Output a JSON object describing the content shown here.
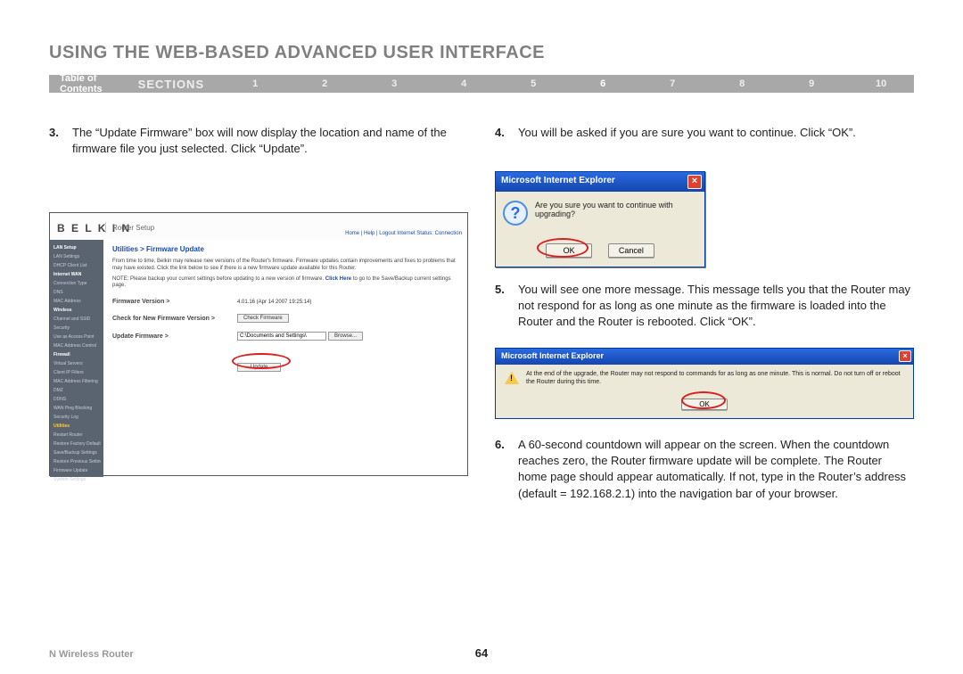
{
  "page": {
    "title": "USING THE WEB-BASED ADVANCED USER INTERFACE",
    "footer_product": "N Wireless Router",
    "page_number": "64"
  },
  "nav": {
    "toc": "Table of Contents",
    "sections_label": "SECTIONS",
    "items": [
      "1",
      "2",
      "3",
      "4",
      "5",
      "6",
      "7",
      "8",
      "9",
      "10"
    ],
    "active": "6"
  },
  "steps": {
    "s3": {
      "num": "3.",
      "text": "The “Update Firmware” box will now display the location and name of the firmware file you just selected. Click “Update”."
    },
    "s4": {
      "num": "4.",
      "text": "You will be asked if you are sure you want to continue. Click “OK”."
    },
    "s5": {
      "num": "5.",
      "text": "You will see one more message. This message tells you that the Router may not respond for as long as one minute as the firmware is loaded into the Router and the Router is rebooted. Click “OK”."
    },
    "s6": {
      "num": "6.",
      "text": "A 60-second countdown will appear on the screen. When the countdown reaches zero, the Router firmware update will be complete. The Router home page should appear automatically. If not, type in the Router’s address (default = 192.168.2.1) into the navigation bar of your browser."
    }
  },
  "belkin_panel": {
    "brand": "B E L K I N",
    "subtitle": "Router Setup",
    "top_links": "Home | Help | Logout   Internet Status: Connection",
    "breadcrumb": "Utilities > Firmware Update",
    "intro": "From time to time, Belkin may release new versions of the Router's firmware. Firmware updates contain improvements and fixes to problems that may have existed. Click the link below to see if there is a new firmware update available for this Router.",
    "note_prefix": "NOTE: Please backup your current settings before updating to a new version of firmware. ",
    "note_link": "Click Here",
    "note_suffix": " to go to the Save/Backup current settings page.",
    "fw_version_label": "Firmware Version >",
    "fw_version_value": "4.01.16 (Apr 14 2007 19:25:14)",
    "check_label": "Check for New Firmware Version >",
    "check_btn": "Check Firmware",
    "update_label": "Update Firmware >",
    "file_path": "C:\\Documents and Settings\\",
    "browse_btn": "Browse...",
    "update_btn": "Update",
    "sidebar": [
      {
        "t": "LAN Setup",
        "b": true
      },
      {
        "t": "LAN Settings"
      },
      {
        "t": "DHCP Client List"
      },
      {
        "t": "Internet WAN",
        "b": true
      },
      {
        "t": "Connection Type"
      },
      {
        "t": "DNS"
      },
      {
        "t": "MAC Address"
      },
      {
        "t": "Wireless",
        "b": true
      },
      {
        "t": "Channel and SSID"
      },
      {
        "t": "Security"
      },
      {
        "t": "Use as Access Point"
      },
      {
        "t": "MAC Address Control"
      },
      {
        "t": "Firewall",
        "b": true
      },
      {
        "t": "Virtual Servers"
      },
      {
        "t": "Client IP Filters"
      },
      {
        "t": "MAC Address Filtering"
      },
      {
        "t": "DMZ"
      },
      {
        "t": "DDNS"
      },
      {
        "t": "WAN Ping Blocking"
      },
      {
        "t": "Security Log"
      },
      {
        "t": "Utilities",
        "a": true
      },
      {
        "t": "Restart Router"
      },
      {
        "t": "Restore Factory Defaults"
      },
      {
        "t": "Save/Backup Settings"
      },
      {
        "t": "Restore Previous Settings"
      },
      {
        "t": "Firmware Update"
      },
      {
        "t": "System Settings"
      }
    ]
  },
  "dialog1": {
    "title": "Microsoft Internet Explorer",
    "msg": "Are you sure you want to continue with upgrading?",
    "ok": "OK",
    "cancel": "Cancel"
  },
  "dialog2": {
    "title": "Microsoft Internet Explorer",
    "msg": "At the end of the upgrade, the Router may not respond to commands for as long as one minute. This is normal. Do not turn off or reboot the Router during this time.",
    "ok": "OK"
  }
}
